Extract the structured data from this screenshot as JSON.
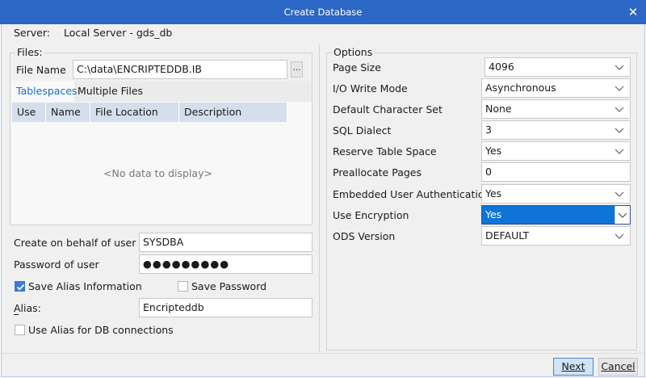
{
  "window": {
    "title": "Create Database"
  },
  "server": {
    "label": "Server:",
    "value": "Local Server - gds_db"
  },
  "files": {
    "legend": "Files:",
    "file_name_label": "File Name",
    "file_name_value": "C:\\data\\ENCRIPTEDDB.IB",
    "browse_label": "...",
    "tabs": [
      "Tablespaces",
      "Multiple Files"
    ],
    "columns": [
      "Use",
      "Name",
      "File Location",
      "Description"
    ],
    "empty_text": "<No data to display>"
  },
  "account": {
    "behalf_label": "Create on behalf of user",
    "behalf_value": "SYSDBA",
    "password_label": "Password of user",
    "password_value": "●●●●●●●●●",
    "save_alias_label": "Save Alias Information",
    "save_alias_checked": true,
    "save_password_label": "Save Password",
    "save_password_checked": false,
    "alias_label": "Alias:",
    "alias_value": "Encripteddb",
    "use_alias_label": "Use Alias for DB connections",
    "use_alias_checked": false
  },
  "options": {
    "legend": "Options",
    "rows": [
      {
        "label": "Page Size",
        "value": "4096"
      },
      {
        "label": "I/O Write Mode",
        "value": "Asynchronous"
      },
      {
        "label": "Default Character Set",
        "value": "None"
      },
      {
        "label": "SQL Dialect",
        "value": "3"
      },
      {
        "label": "Reserve Table Space",
        "value": "Yes"
      },
      {
        "label": "Preallocate Pages",
        "value": "0"
      },
      {
        "label": "Embedded User Authentication",
        "value": "Yes"
      },
      {
        "label": "Use Encryption",
        "value": "Yes"
      },
      {
        "label": "ODS Version",
        "value": "DEFAULT"
      }
    ]
  },
  "buttons": {
    "next": "Next",
    "cancel": "Cancel"
  },
  "colors": {
    "titlebar": "#2b67c5",
    "selection": "#0e74d8",
    "grid_header": "#d5dfec",
    "checkbox_checked": "#3a7bd5"
  }
}
